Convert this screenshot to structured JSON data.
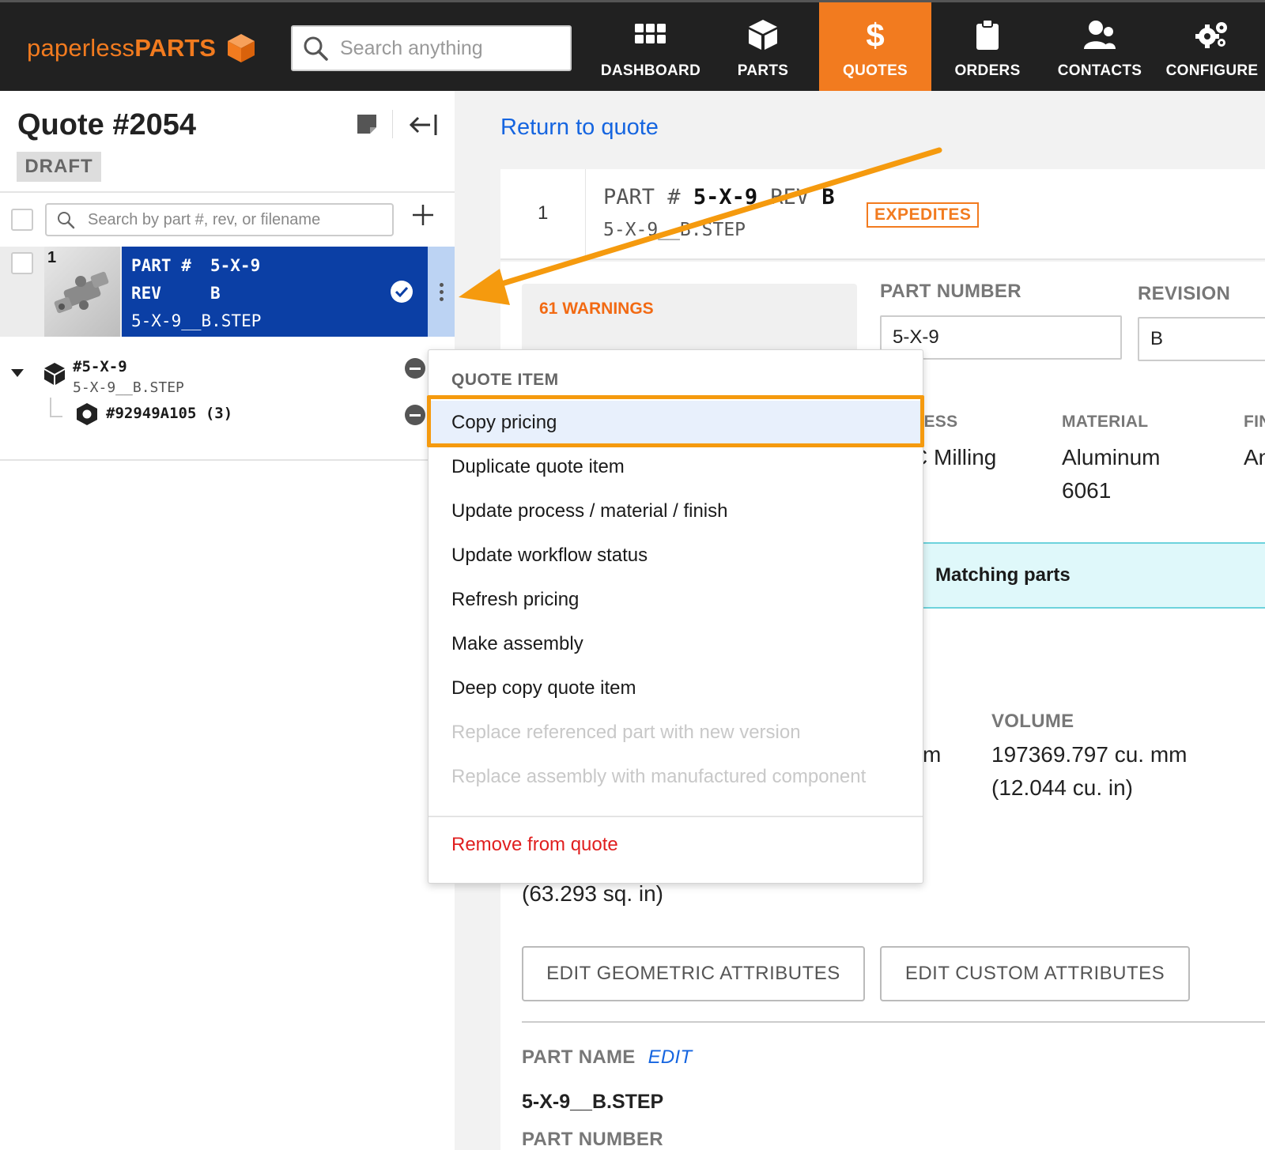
{
  "app": {
    "logo_part1": "paperless",
    "logo_part2": "PARTS",
    "search_placeholder": "Search anything"
  },
  "nav": [
    {
      "label": "DASHBOARD",
      "icon": "grid-icon"
    },
    {
      "label": "PARTS",
      "icon": "cube-icon"
    },
    {
      "label": "QUOTES",
      "icon": "dollar-icon",
      "active": true
    },
    {
      "label": "ORDERS",
      "icon": "clipboard-icon"
    },
    {
      "label": "CONTACTS",
      "icon": "users-icon"
    },
    {
      "label": "CONFIGURE",
      "icon": "gears-icon"
    }
  ],
  "sidebar": {
    "quote_title": "Quote #2054",
    "status": "DRAFT",
    "search_placeholder": "Search by part #, rev, or filename",
    "item": {
      "number": "1",
      "part_label": "PART #",
      "part_value": "5-X-9",
      "rev_label": "REV",
      "rev_value": "B",
      "filename": "5-X-9__B.STEP"
    },
    "tree": {
      "root_name": "#5-X-9",
      "root_file": "5-X-9__B.STEP",
      "child_name": "#92949A105 (3)"
    }
  },
  "main": {
    "return_link": "Return to quote",
    "header": {
      "number": "1",
      "part_label": "PART #",
      "part_value": "5-X-9",
      "rev_label": "REV",
      "rev_value": "B",
      "filename": "5-X-9__B.STEP",
      "badge": "EXPEDITES"
    },
    "warnings": "61 WARNINGS",
    "part_number_label": "PART NUMBER",
    "part_number_value": "5-X-9",
    "revision_label": "REVISION",
    "revision_value": "B",
    "process_label_partial": "CESS",
    "process_value_partial": "C Milling",
    "material_label": "MATERIAL",
    "material_line1": "Aluminum",
    "material_line2": "6061",
    "finish_label_partial": "FIN",
    "finish_value_partial": "An",
    "matching_parts": "Matching parts",
    "area_partial": "m",
    "volume_label": "VOLUME",
    "volume_line1": "197369.797 cu. mm",
    "volume_line2": "(12.044 cu. in)",
    "area_in": "(63.293 sq. in)",
    "btn_geometric": "EDIT GEOMETRIC ATTRIBUTES",
    "btn_custom": "EDIT CUSTOM ATTRIBUTES",
    "part_name_label": "PART NAME",
    "part_name_edit": "EDIT",
    "part_name_value": "5-X-9__B.STEP",
    "part_number_label2": "PART NUMBER"
  },
  "menu": {
    "header": "QUOTE ITEM",
    "items": [
      {
        "label": "Copy pricing",
        "state": "highlighted"
      },
      {
        "label": "Duplicate quote item",
        "state": "enabled"
      },
      {
        "label": "Update process / material / finish",
        "state": "enabled"
      },
      {
        "label": "Update workflow status",
        "state": "enabled"
      },
      {
        "label": "Refresh pricing",
        "state": "enabled"
      },
      {
        "label": "Make assembly",
        "state": "enabled"
      },
      {
        "label": "Deep copy quote item",
        "state": "enabled"
      },
      {
        "label": "Replace referenced part with new version",
        "state": "disabled"
      },
      {
        "label": "Replace assembly with manufactured component",
        "state": "disabled"
      }
    ],
    "danger_item": "Remove from quote"
  },
  "colors": {
    "brand_orange": "#f27b1f",
    "nav_bg": "#212121",
    "selected_blue": "#0b3fa5",
    "link_blue": "#1565e0",
    "danger_red": "#e01f1f",
    "annotation_orange": "#f59a0e"
  }
}
